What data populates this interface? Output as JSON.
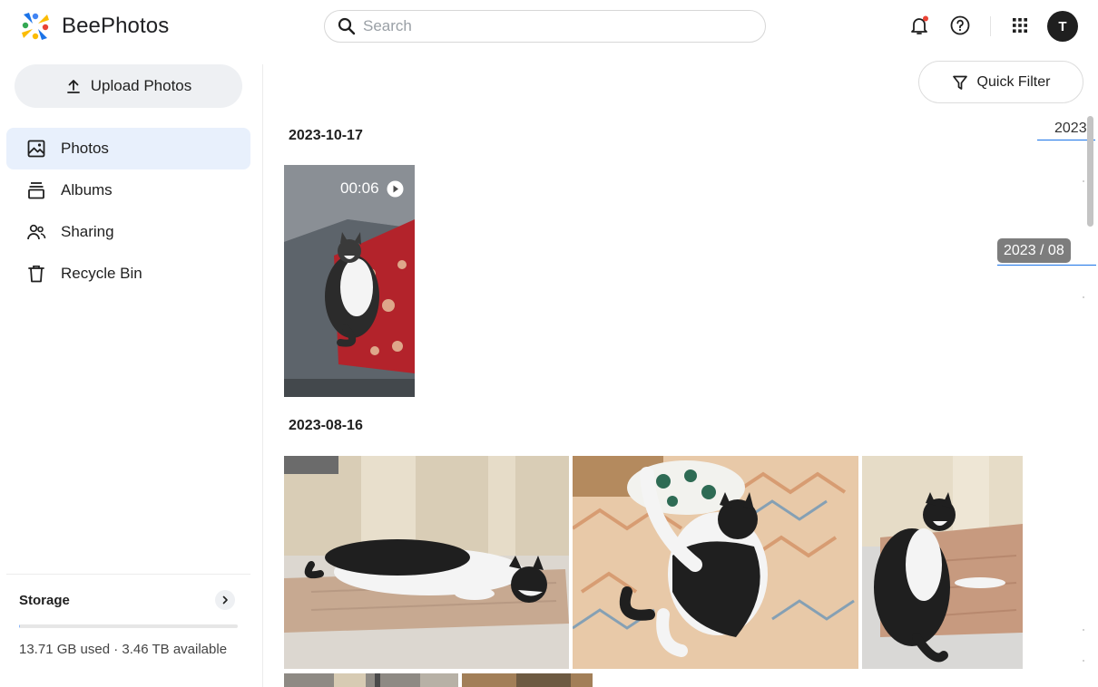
{
  "app": {
    "name": "BeePhotos"
  },
  "search": {
    "placeholder": "Search"
  },
  "header": {
    "avatar_initial": "T",
    "icons": [
      "bell-icon",
      "help-icon",
      "apps-grid-icon"
    ],
    "colors": {
      "notification_dot": "#ea4335"
    }
  },
  "sidebar": {
    "upload_label": "Upload Photos",
    "items": [
      {
        "label": "Photos",
        "icon": "photo-icon",
        "active": true
      },
      {
        "label": "Albums",
        "icon": "albums-icon",
        "active": false
      },
      {
        "label": "Sharing",
        "icon": "people-icon",
        "active": false
      },
      {
        "label": "Recycle Bin",
        "icon": "trash-icon",
        "active": false
      }
    ],
    "storage": {
      "title": "Storage",
      "used_text": "13.71 GB used · 3.46 TB available",
      "used_fraction": 0.004
    }
  },
  "main": {
    "quick_filter_label": "Quick Filter",
    "groups": [
      {
        "date": "2023-10-17",
        "items": [
          {
            "type": "video",
            "duration": "00:06"
          }
        ]
      },
      {
        "date": "2023-08-16",
        "items": [
          {
            "type": "photo"
          },
          {
            "type": "photo"
          },
          {
            "type": "photo"
          },
          {
            "type": "photo"
          },
          {
            "type": "photo"
          }
        ]
      }
    ]
  },
  "scrubber": {
    "year": "2023",
    "current": "2023 / 08"
  },
  "colors": {
    "accent": "#1a73e8",
    "active_nav_bg": "#e8f0fc",
    "scrub_tag_bg": "#7d7d7d"
  }
}
